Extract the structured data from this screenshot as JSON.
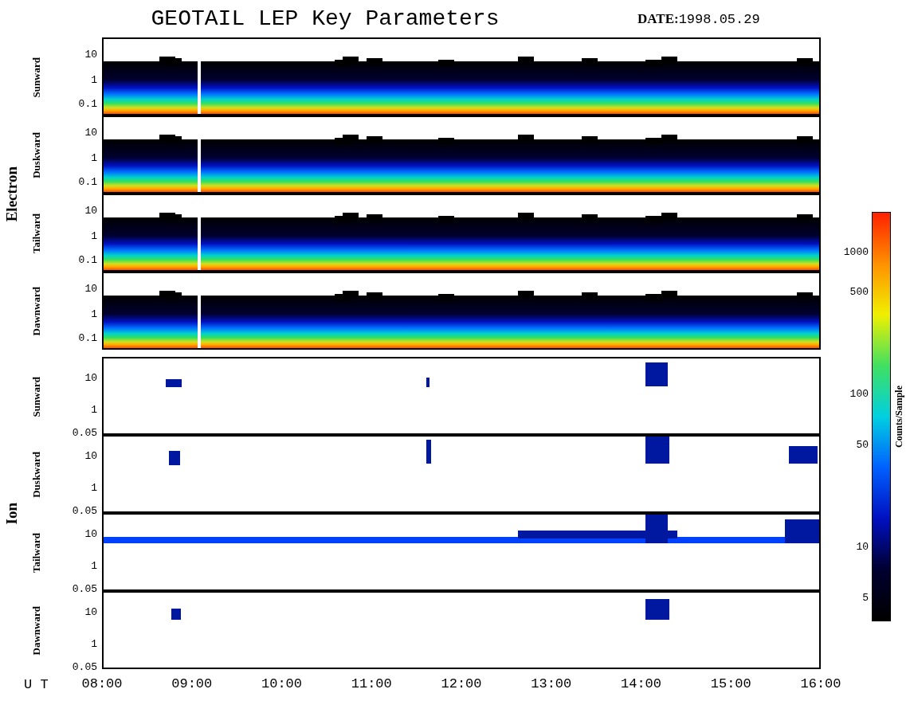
{
  "title": "GEOTAIL LEP Key Parameters",
  "date": {
    "label": "DATE:",
    "value": "1998.05.29"
  },
  "groups": [
    {
      "name": "Electron",
      "kind": "electron",
      "panels": [
        {
          "label": "Sunward",
          "yticks": [
            "10",
            "1",
            "0.1"
          ]
        },
        {
          "label": "Duskward",
          "yticks": [
            "10",
            "1",
            "0.1"
          ]
        },
        {
          "label": "Tailward",
          "yticks": [
            "10",
            "1",
            "0.1"
          ]
        },
        {
          "label": "Dawnward",
          "yticks": [
            "10",
            "1",
            "0.1"
          ]
        }
      ]
    },
    {
      "name": "Ion",
      "kind": "ion",
      "panels": [
        {
          "label": "Sunward",
          "yticks": [
            "10",
            "1",
            "0.05"
          ]
        },
        {
          "label": "Duskward",
          "yticks": [
            "10",
            "1",
            "0.05"
          ]
        },
        {
          "label": "Tailward",
          "yticks": [
            "10",
            "1",
            "0.05"
          ]
        },
        {
          "label": "Dawnward",
          "yticks": [
            "10",
            "1",
            "0.05"
          ]
        }
      ]
    }
  ],
  "colorbar": {
    "label": "Counts/Sample",
    "ticks": [
      "1000",
      "500",
      "100",
      "50",
      "10",
      "5"
    ]
  },
  "xaxis": {
    "label": "U T",
    "ticks": [
      "08:00",
      "09:00",
      "10:00",
      "11:00",
      "12:00",
      "13:00",
      "14:00",
      "15:00",
      "16:00"
    ]
  }
}
